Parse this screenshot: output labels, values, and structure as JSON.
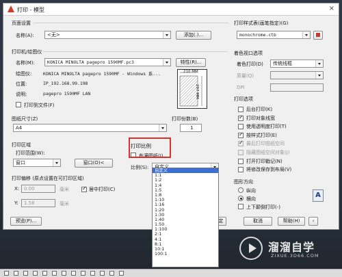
{
  "window": {
    "title": "打印 - 模型",
    "close_glyph": "×"
  },
  "page_setup": {
    "section_label": "页面设置",
    "name_label": "名称(A):",
    "name_value": "<无>",
    "add_button": "添加(.)..."
  },
  "printer": {
    "section_label": "打印机/绘图仪",
    "name_label": "名称(M):",
    "name_value": "KONICA MINOLTA pagepro 1590MF.pc3",
    "properties_button": "特性(R)...",
    "plotter_label": "绘图仪:",
    "plotter_value": "KONICA MINOLTA pagepro 1590MF - Windows 系...",
    "where_label": "位置:",
    "where_value": "IP_192.168.99.198",
    "desc_label": "说明:",
    "desc_value": "pagepro 1590MF LAN",
    "print_to_file": "打印到文件(F)",
    "preview_width": "210 MM",
    "preview_height": "297 MM"
  },
  "paper": {
    "section_label": "图纸尺寸(Z)",
    "value": "A4",
    "copies_label": "打印份数(B)",
    "copies_value": "1"
  },
  "plot_area": {
    "section_label": "打印区域",
    "what_label": "打印范围(W):",
    "what_value": "窗口",
    "window_button": "窗口(O)<"
  },
  "plot_offset": {
    "section_label": "打印偏移 (原点设置在可打印区域)",
    "x_label": "X:",
    "x_value": "0.00",
    "x_unit": "毫米",
    "y_label": "Y:",
    "y_value": "1.58",
    "y_unit": "毫米",
    "center_label": "居中打印(C)"
  },
  "plot_scale": {
    "section_label": "打印比例",
    "fit_label": "布满图纸(I)",
    "scale_label": "比例(S):",
    "scale_value": "自定义",
    "options": [
      "自定义",
      "1:1",
      "1:2",
      "1:4",
      "1:5",
      "1:8",
      "1:10",
      "1:16",
      "1:20",
      "1:30",
      "1:40",
      "1:50",
      "1:100",
      "2:1",
      "4:1",
      "8:1",
      "10:1",
      "100:1"
    ]
  },
  "plot_style": {
    "section_label": "打印样式表(画笔指定)(G)",
    "value": "monochrome.ctb"
  },
  "shaded": {
    "section_label": "着色视口选项",
    "shade_label": "着色打印(D)",
    "shade_value": "传统线框",
    "quality_label": "质量(Q)",
    "dpi_label": "DPI"
  },
  "plot_options": {
    "section_label": "打印选项",
    "items": [
      {
        "label": "后台打印(K)",
        "checked": false,
        "enabled": true
      },
      {
        "label": "打印对象线宽",
        "checked": true,
        "enabled": true
      },
      {
        "label": "使用透明度打印(T)",
        "checked": false,
        "enabled": true
      },
      {
        "label": "按样式打印(E)",
        "checked": true,
        "enabled": true
      },
      {
        "label": "最后打印图纸空间",
        "checked": true,
        "enabled": false
      },
      {
        "label": "隐藏图纸空间对象(J)",
        "checked": false,
        "enabled": false
      },
      {
        "label": "打开打印戳记(N)",
        "checked": false,
        "enabled": true
      },
      {
        "label": "将修改保存到布局(V)",
        "checked": false,
        "enabled": true
      }
    ]
  },
  "orientation": {
    "section_label": "图形方向",
    "portrait": "纵向",
    "landscape": "横向",
    "upside_down": "上下颠倒打印(-)",
    "selected": "landscape",
    "icon_letter": "A"
  },
  "footer": {
    "preview_button": "预览(P)...",
    "ok_button": "定",
    "cancel_button": "取消",
    "help_button": "帮助(H)"
  },
  "watermark": {
    "brand": "溜溜自学",
    "url": "ZIXUE.3D66.COM"
  },
  "colors": {
    "highlight_red": "#d9322b",
    "selection_blue": "#3b6fd1"
  }
}
